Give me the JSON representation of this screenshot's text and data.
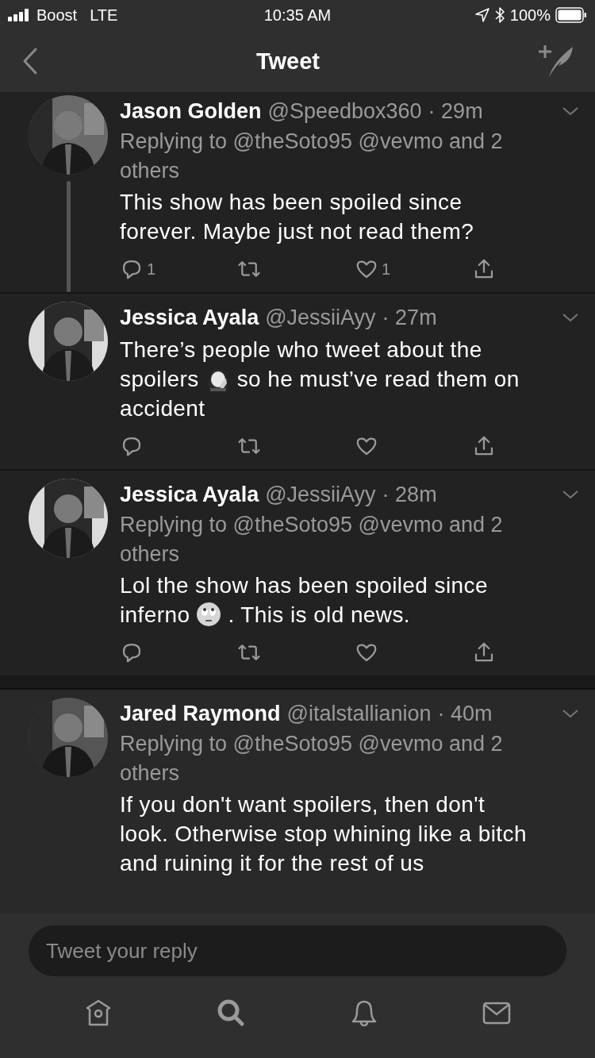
{
  "status_bar": {
    "carrier": "Boost",
    "network": "LTE",
    "time": "10:35 AM",
    "battery": "100%"
  },
  "nav": {
    "title": "Tweet"
  },
  "tweets": [
    {
      "name": "Jason Golden",
      "handle": "@Speedbox360",
      "time": "· 29m",
      "thread_below": true,
      "replying": "Replying to @theSoto95 @vevmo and 2 others",
      "body": [
        {
          "kind": "text",
          "text": "This show has been spoiled since forever. Maybe just not read them?"
        }
      ],
      "replies": "1",
      "likes": "1",
      "actions": true,
      "section_gap": false
    },
    {
      "name": "Jessica Ayala",
      "handle": "@JessiiAyy",
      "time": "· 27m",
      "thread_below": false,
      "body": [
        {
          "kind": "text",
          "text": "There’s people who tweet about the spoilers"
        },
        {
          "kind": "facepalm"
        },
        {
          "kind": "text",
          "text": "so he must’ve read them on accident"
        }
      ],
      "actions": true,
      "section_gap": false
    },
    {
      "name": "Jessica Ayala",
      "handle": "@JessiiAyy",
      "time": "· 28m",
      "thread_below": false,
      "replying": "Replying to @theSoto95 @vevmo and 2 others",
      "body": [
        {
          "kind": "text",
          "text": "Lol the show has been spoiled since inferno"
        },
        {
          "kind": "eyeroll"
        },
        {
          "kind": "text",
          "text": ". This is old news."
        }
      ],
      "actions": true,
      "section_gap": true
    },
    {
      "name": "Jared Raymond",
      "handle": "@italstallianion",
      "time": "· 40m",
      "thread_below": false,
      "replying": "Replying to @theSoto95 @vevmo and 2 others",
      "body": [
        {
          "kind": "text",
          "text": "If you don't want spoilers, then don't look. Otherwise stop whining like a bitch and ruining it for the rest of us"
        }
      ]
    }
  ],
  "reply": {
    "placeholder": "Tweet your reply"
  }
}
